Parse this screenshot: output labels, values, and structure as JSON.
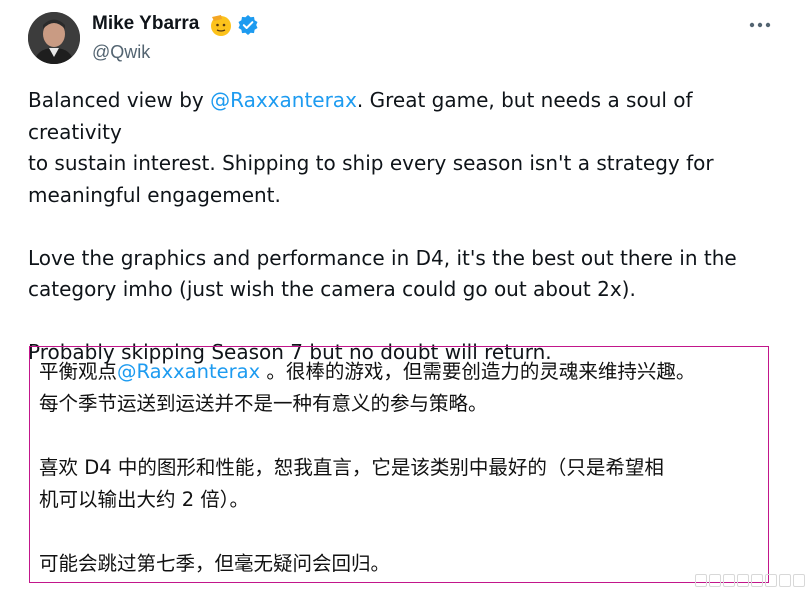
{
  "tweet": {
    "author_name": "Mike Ybarra",
    "handle": "@Qwik",
    "p1_before": "Balanced view by ",
    "p1_mention": "@Raxxanterax",
    "p1_after": ". Great game, but needs a soul of creativity\nto sustain interest. Shipping to ship every season isn't a strategy for\nmeaningful engagement.",
    "p2": "Love the graphics and performance in D4, it's the best out there in the\ncategory imho (just wish the camera could go out about 2x).",
    "p3": "Probably skipping Season 7 but no doubt will return."
  },
  "translation": {
    "t1_before": "平衡观点",
    "t1_mention": "@Raxxanterax",
    "t1_after": " 。很棒的游戏，但需要创造力的灵魂来维持兴趣。\n每个季节运送到运送并不是一种有意义的参与策略。",
    "t2": "喜欢 D4 中的图形和性能，恕我直言，它是该类别中最好的（只是希望相\n机可以输出大约 2 倍）。",
    "t3": "可能会跳过第七季，但毫无疑问会回归。"
  },
  "icons": {
    "avatar": "avatar-photo",
    "name_emoji": "saluting-face-emoji",
    "verified": "verified-badge-icon",
    "more": "more-options-icon"
  },
  "colors": {
    "link": "#1d9bf0",
    "translation_border": "#c2168b",
    "secondary_text": "#536471"
  }
}
